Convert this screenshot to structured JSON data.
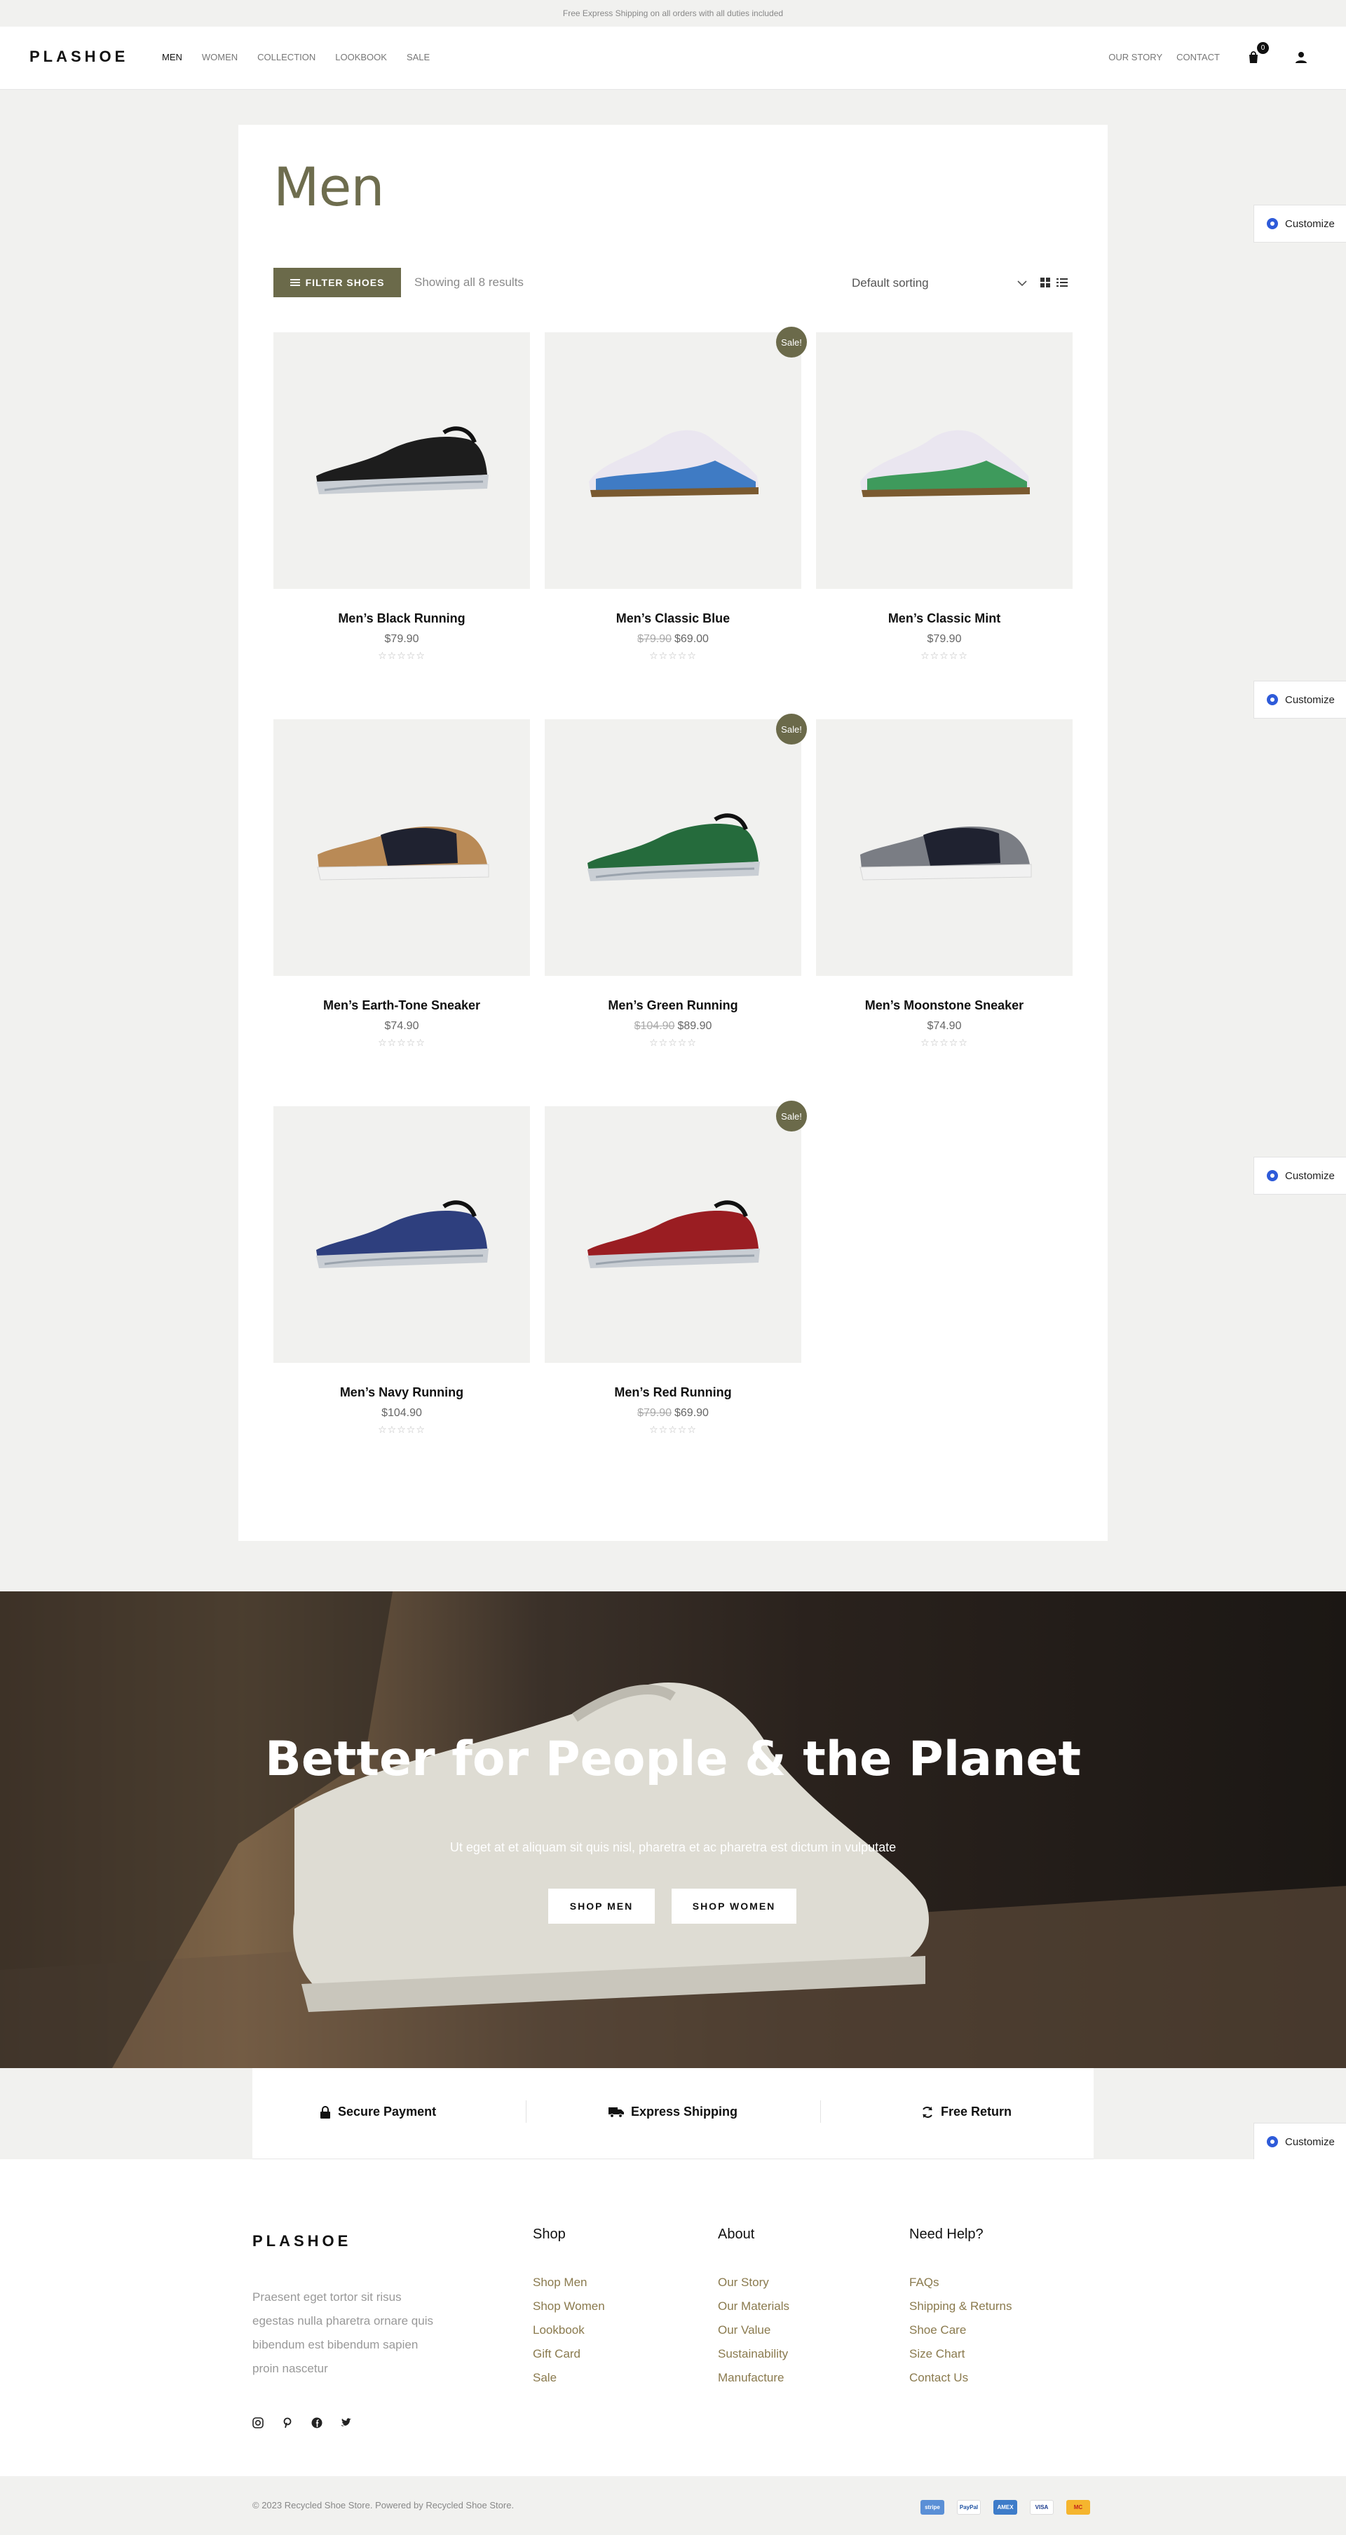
{
  "topbar": {
    "text": "Free Express Shipping on all orders with all duties included"
  },
  "header": {
    "logo": "PLASHOE",
    "nav": [
      "MEN",
      "WOMEN",
      "COLLECTION",
      "LOOKBOOK",
      "SALE"
    ],
    "nav_right": [
      "OUR STORY",
      "CONTACT"
    ],
    "cart_count": "0"
  },
  "shop": {
    "title": "Men",
    "filter_label": "FILTER SHOES",
    "results_text": "Showing all 8 results",
    "sorting": "Default sorting",
    "stars": "☆☆☆☆☆",
    "sale_badge": "Sale!"
  },
  "products": [
    {
      "name": "Men’s Black Running",
      "price": "$79.90",
      "old_price": "",
      "sale": false,
      "color": "#1d1d1d",
      "style": "runner"
    },
    {
      "name": "Men’s Classic Blue",
      "price": "$69.00",
      "old_price": "$79.90",
      "sale": true,
      "color": "#3f7bc4",
      "style": "classic"
    },
    {
      "name": "Men’s Classic Mint",
      "price": "$79.90",
      "old_price": "",
      "sale": false,
      "color": "#3e9a5c",
      "style": "classic"
    },
    {
      "name": "Men’s Earth-Tone Sneaker",
      "price": "$74.90",
      "old_price": "",
      "sale": false,
      "color": "#b98a56",
      "style": "sneaker"
    },
    {
      "name": "Men’s Green Running",
      "price": "$89.90",
      "old_price": "$104.90",
      "sale": true,
      "color": "#256b3c",
      "style": "runner"
    },
    {
      "name": "Men’s Moonstone Sneaker",
      "price": "$74.90",
      "old_price": "",
      "sale": false,
      "color": "#7a7d84",
      "style": "sneaker"
    },
    {
      "name": "Men’s Navy Running",
      "price": "$104.90",
      "old_price": "",
      "sale": false,
      "color": "#2e3f7e",
      "style": "runner"
    },
    {
      "name": "Men’s Red Running",
      "price": "$69.90",
      "old_price": "$79.90",
      "sale": true,
      "color": "#9a1d22",
      "style": "runner"
    }
  ],
  "customize_label": "Customize",
  "hero": {
    "title": "Better for People & the Planet",
    "subtitle": "Ut eget at et aliquam sit quis nisl, pharetra et ac pharetra est dictum in vulputate",
    "btn_men": "SHOP MEN",
    "btn_women": "SHOP WOMEN"
  },
  "features": [
    "Secure Payment",
    "Express Shipping",
    "Free Return"
  ],
  "footer": {
    "logo": "PLASHOE",
    "description": "Praesent eget tortor sit risus egestas nulla pharetra ornare quis bibendum est bibendum sapien proin nascetur",
    "columns": [
      {
        "title": "Shop",
        "links": [
          "Shop Men",
          "Shop Women",
          "Lookbook",
          "Gift Card",
          "Sale"
        ]
      },
      {
        "title": "About",
        "links": [
          "Our Story",
          "Our Materials",
          "Our Value",
          "Sustainability",
          "Manufacture"
        ]
      },
      {
        "title": "Need Help?",
        "links": [
          "FAQs",
          "Shipping & Returns",
          "Shoe Care",
          "Size Chart",
          "Contact Us"
        ]
      }
    ],
    "copyright": "© 2023 Recycled Shoe Store. Powered by Recycled Shoe Store.",
    "payments": [
      "stripe",
      "PayPal",
      "AMEX",
      "VISA",
      "MC"
    ]
  }
}
